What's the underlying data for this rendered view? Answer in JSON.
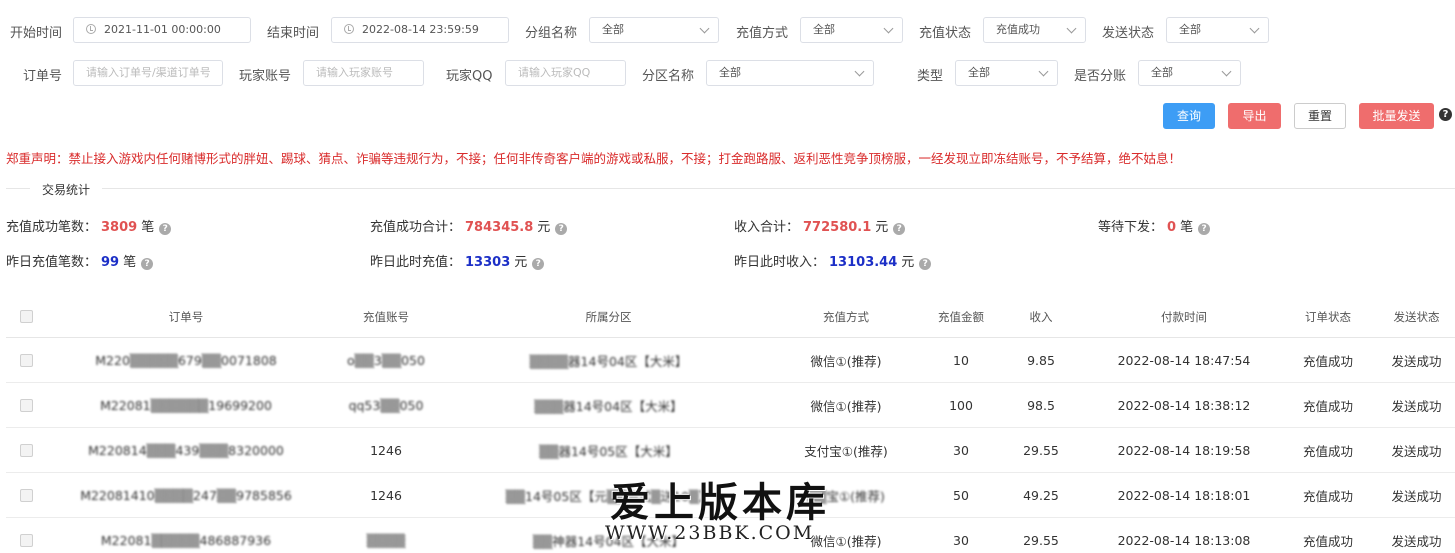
{
  "filters": {
    "start_label": "开始时间",
    "start_value": "2021-11-01 00:00:00",
    "end_label": "结束时间",
    "end_value": "2022-08-14 23:59:59",
    "group_label": "分组名称",
    "group_value": "全部",
    "recharge_method_label": "充值方式",
    "recharge_method_value": "全部",
    "recharge_status_label": "充值状态",
    "recharge_status_value": "充值成功",
    "send_status_label": "发送状态",
    "send_status_value": "全部",
    "order_label": "订单号",
    "order_placeholder": "请输入订单号/渠道订单号",
    "player_label": "玩家账号",
    "player_placeholder": "请输入玩家账号",
    "qq_label": "玩家QQ",
    "qq_placeholder": "请输入玩家QQ",
    "zone_label": "分区名称",
    "zone_value": "全部",
    "type_label": "类型",
    "type_value": "全部",
    "split_label": "是否分账",
    "split_value": "全部"
  },
  "actions": {
    "query": "查询",
    "export": "导出",
    "reset": "重置",
    "batch_send": "批量发送",
    "help": "?"
  },
  "notice": "郑重声明：禁止接入游戏内任何赌博形式的胖妞、踢球、猜点、诈骗等违规行为，不接；任何非传奇客户端的游戏或私服，不接；打金跑路服、返利恶性竞争顶榜服，一经发现立即冻结账号，不予结算，绝不姑息！",
  "section_title": "交易统计",
  "stats": {
    "success_count_label": "充值成功笔数：",
    "success_count_value": "3809",
    "success_count_unit": "笔",
    "success_total_label": "充值成功合计：",
    "success_total_value": "784345.8",
    "success_total_unit": "元",
    "income_total_label": "收入合计：",
    "income_total_value": "772580.1",
    "income_total_unit": "元",
    "pending_label": "等待下发：",
    "pending_value": "0",
    "pending_unit": "笔",
    "yday_count_label": "昨日充值笔数：",
    "yday_count_value": "99",
    "yday_count_unit": "笔",
    "yday_recharge_label": "昨日此时充值：",
    "yday_recharge_value": "13303",
    "yday_recharge_unit": "元",
    "yday_income_label": "昨日此时收入：",
    "yday_income_value": "13103.44",
    "yday_income_unit": "元"
  },
  "table": {
    "headers": {
      "order": "订单号",
      "account": "充值账号",
      "zone": "所属分区",
      "method": "充值方式",
      "amount": "充值金额",
      "income": "收入",
      "pay_time": "付款时间",
      "order_status": "订单状态",
      "send_status": "发送状态"
    },
    "rows": [
      {
        "order": "M220▒▒▒▒▒679▒▒0071808",
        "account": "o▒▒3▒▒050",
        "zone": "▒▒▒▒器14号04区【大米】",
        "method": "微信①(推荐)",
        "amount": "10",
        "income": "9.85",
        "pay_time": "2022-08-14 18:47:54",
        "order_status": "充值成功",
        "send_status": "发送成功"
      },
      {
        "order": "M22081▒▒▒▒▒▒19699200",
        "account": "qq53▒▒050",
        "zone": "▒▒▒器14号04区【大米】",
        "method": "微信①(推荐)",
        "amount": "100",
        "income": "98.5",
        "pay_time": "2022-08-14 18:38:12",
        "order_status": "充值成功",
        "send_status": "发送成功"
      },
      {
        "order": "M220814▒▒▒439▒▒▒8320000",
        "account": "1246",
        "zone": "▒▒器14号05区【大米】",
        "method": "支付宝①(推荐)",
        "amount": "30",
        "income": "29.55",
        "pay_time": "2022-08-14 18:19:58",
        "order_status": "充值成功",
        "send_status": "发送成功"
      },
      {
        "order": "M22081410▒▒▒▒247▒▒9785856",
        "account": "1246",
        "zone": "▒▒14号05区【元▒▒测试▒送10▒】",
        "method": "▒▒宝①(推荐)",
        "amount": "50",
        "income": "49.25",
        "pay_time": "2022-08-14 18:18:01",
        "order_status": "充值成功",
        "send_status": "发送成功"
      },
      {
        "order": "M22081▒▒▒▒▒486887936",
        "account": "▒▒▒▒",
        "zone": "▒▒神器14号04区【大米】",
        "method": "微信①(推荐)",
        "amount": "30",
        "income": "29.55",
        "pay_time": "2022-08-14 18:13:08",
        "order_status": "充值成功",
        "send_status": "发送成功"
      }
    ]
  },
  "watermark": {
    "title": "爱上版本库",
    "url": "WWW.23BBK.COM"
  }
}
